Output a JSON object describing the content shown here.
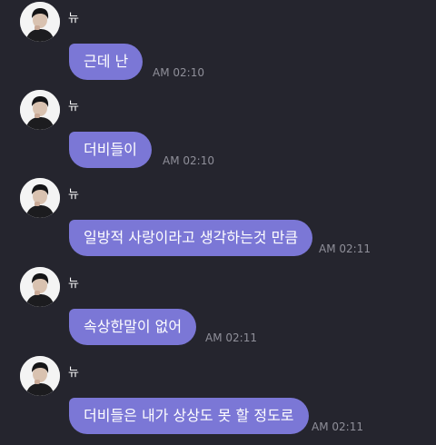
{
  "messages": [
    {
      "sender": "뉴",
      "text": "근데 난",
      "time": "AM 02:10"
    },
    {
      "sender": "뉴",
      "text": "더비들이",
      "time": "AM 02:10"
    },
    {
      "sender": "뉴",
      "text": "일방적 사랑이라고 생각하는것 만큼",
      "time": "AM 02:11"
    },
    {
      "sender": "뉴",
      "text": "속상한말이 없어",
      "time": "AM 02:11"
    },
    {
      "sender": "뉴",
      "text": "더비들은 내가 상상도 못 할 정도로",
      "time": "AM 02:11"
    }
  ],
  "colors": {
    "background": "#25252e",
    "bubble": "#7b77d6",
    "timestamp": "#8f8f99"
  },
  "icons": {
    "avatar": "profile-photo-avatar"
  }
}
